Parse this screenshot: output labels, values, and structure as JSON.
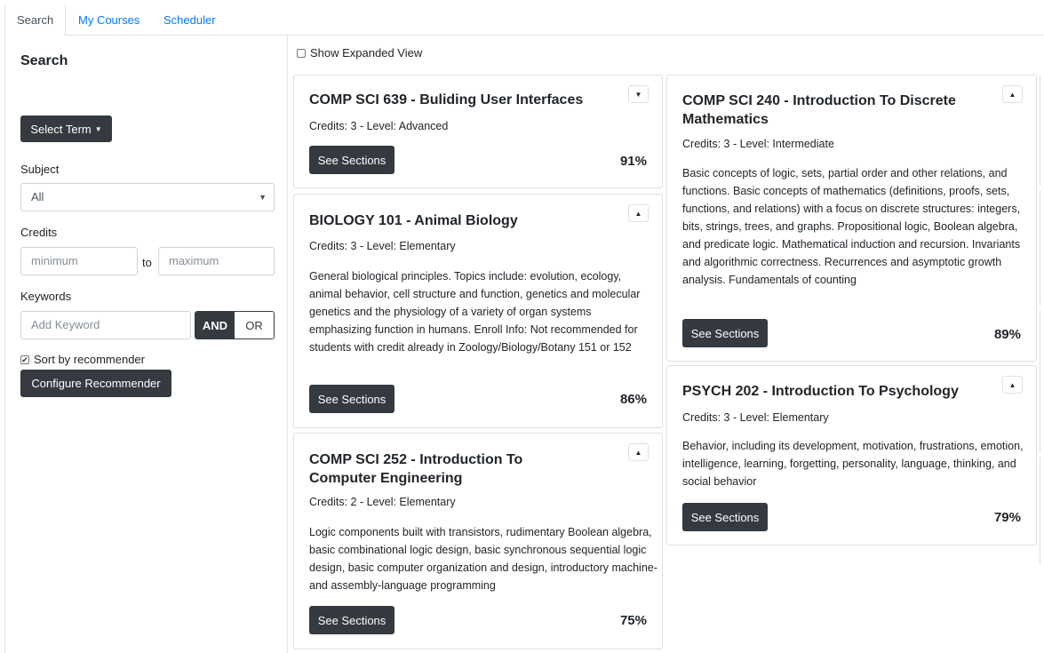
{
  "tabs": [
    {
      "label": "Search"
    },
    {
      "label": "My Courses"
    },
    {
      "label": "Scheduler"
    }
  ],
  "sidebar": {
    "title": "Search",
    "select_term_label": "Select Term",
    "subject_label": "Subject",
    "subject_value": "All",
    "credits_label": "Credits",
    "credits_min_placeholder": "minimum",
    "credits_to": "to",
    "credits_max_placeholder": "maximum",
    "keywords_label": "Keywords",
    "keyword_placeholder": "Add Keyword",
    "and_label": "AND",
    "or_label": "OR",
    "sort_label": "Sort by recommender",
    "sort_checked": true,
    "configure_label": "Configure Recommender"
  },
  "main": {
    "expanded_label": "Show Expanded View",
    "see_sections_label": "See Sections",
    "courses": [
      {
        "title": "COMP SCI 639 - Buliding User Interfaces",
        "meta": "Credits: 3 - Level: Advanced",
        "description": "",
        "score": "91%",
        "toggle": "▼"
      },
      {
        "title": "BIOLOGY 101 - Animal Biology",
        "meta": "Credits: 3 - Level: Elementary",
        "description": "General biological principles. Topics include: evolution, ecology, animal behavior, cell structure and function, genetics and molecular genetics and the physiology of a variety of organ systems emphasizing function in humans. Enroll Info: Not recommended for students with credit already in Zoology/Biology/Botany 151 or 152",
        "score": "86%",
        "toggle": "▲"
      },
      {
        "title": "COMP SCI 252 - Introduction To Computer Engineering",
        "meta": "Credits: 2 - Level: Elementary",
        "description": "Logic components built with transistors, rudimentary Boolean algebra, basic combinational logic design, basic synchronous sequential logic design, basic computer organization and design, introductory machine- and assembly-language programming",
        "score": "75%",
        "toggle": "▲"
      },
      {
        "title": "COMP SCI 240 - Introduction To Discrete Mathematics",
        "meta": "Credits: 3 - Level: Intermediate",
        "description": "Basic concepts of logic, sets, partial order and other relations, and functions. Basic concepts of mathematics (definitions, proofs, sets, functions, and relations) with a focus on discrete structures: integers, bits, strings, trees, and graphs. Propositional logic, Boolean algebra, and predicate logic. Mathematical induction and recursion. Invariants and algorithmic correctness. Recurrences and asymptotic growth analysis. Fundamentals of counting",
        "score": "89%",
        "toggle": "▲"
      },
      {
        "title": "PSYCH 202 - Introduction To Psychology",
        "meta": "Credits: 3 - Level: Elementary",
        "description": "Behavior, including its development, motivation, frustrations, emotion, intelligence, learning, forgetting, personality, language, thinking, and social behavior",
        "score": "79%",
        "toggle": "▲"
      }
    ]
  }
}
